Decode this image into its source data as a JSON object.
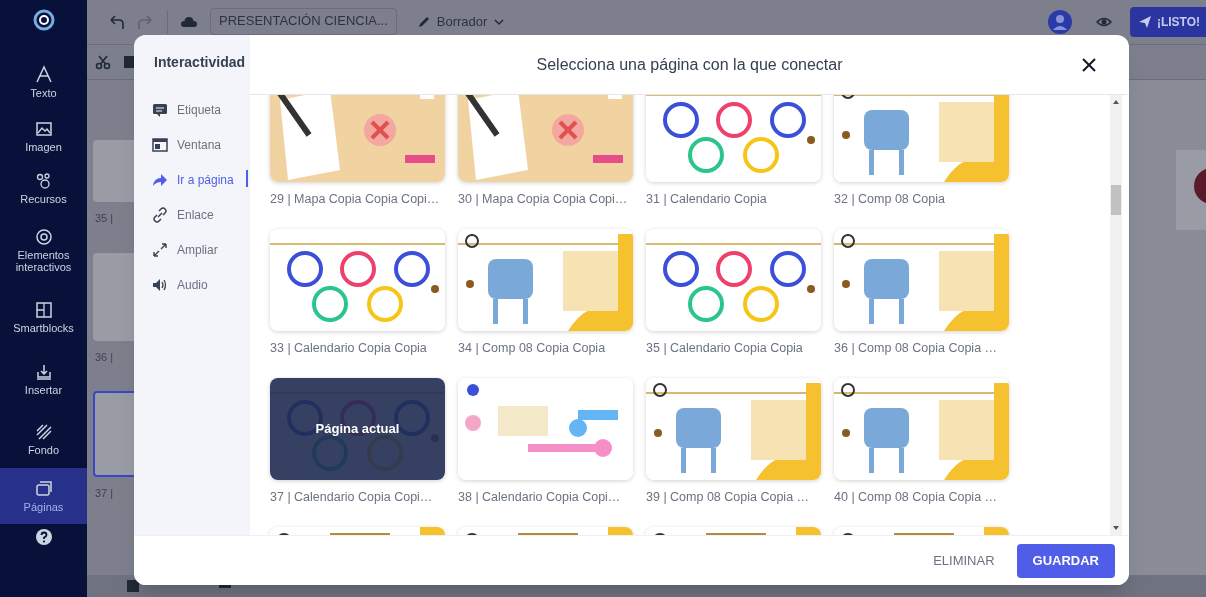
{
  "sidebar": {
    "items": [
      {
        "label": "Texto",
        "selected": false
      },
      {
        "label": "Imagen",
        "selected": false
      },
      {
        "label": "Recursos",
        "selected": false
      },
      {
        "label": "Elementos interactivos",
        "selected": false
      },
      {
        "label": "Smartblocks",
        "selected": false
      },
      {
        "label": "Insertar",
        "selected": false
      },
      {
        "label": "Fondo",
        "selected": false
      },
      {
        "label": "Páginas",
        "selected": true
      }
    ]
  },
  "toolbar": {
    "document_title": "PRESENTACIÓN CIENCIA...",
    "status": "Borrador",
    "publish_button": "¡LISTO!"
  },
  "pages_panel": {
    "pages": [
      {
        "label": "35 |",
        "selected": false
      },
      {
        "label": "36 |",
        "selected": false
      },
      {
        "label": "37 |",
        "selected": true
      }
    ]
  },
  "dialog": {
    "menu_title": "Interactividad",
    "title": "Selecciona una página con la que conectar",
    "menu": [
      {
        "label": "Etiqueta",
        "selected": false
      },
      {
        "label": "Ventana",
        "selected": false
      },
      {
        "label": "Ir a página",
        "selected": true
      },
      {
        "label": "Enlace",
        "selected": false
      },
      {
        "label": "Ampliar",
        "selected": false
      },
      {
        "label": "Audio",
        "selected": false
      }
    ],
    "pages": [
      {
        "label": "29 | Mapa Copia Copia Copi…",
        "current": false
      },
      {
        "label": "30 | Mapa Copia Copia Copi…",
        "current": false
      },
      {
        "label": "31 | Calendario Copia",
        "current": false
      },
      {
        "label": "32 | Comp 08 Copia",
        "current": false
      },
      {
        "label": "33 | Calendario Copia Copia",
        "current": false
      },
      {
        "label": "34 | Comp 08 Copia Copia",
        "current": false
      },
      {
        "label": "35 | Calendario Copia Copia",
        "current": false
      },
      {
        "label": "36 | Comp 08 Copia Copia …",
        "current": false
      },
      {
        "label": "37 | Calendario Copia Copi…",
        "current": true,
        "badge": "Página actual"
      },
      {
        "label": "38 | Calendario Copia Copi…",
        "current": false
      },
      {
        "label": "39 | Comp 08 Copia Copia …",
        "current": false
      },
      {
        "label": "40 | Comp 08 Copia Copia …",
        "current": false
      },
      {
        "current": false
      },
      {
        "current": false
      },
      {
        "current": false
      },
      {
        "current": false
      }
    ],
    "buttons": [
      {
        "label": "ELIMINAR",
        "kind": "text"
      },
      {
        "label": "GUARDAR",
        "kind": "primary"
      }
    ]
  }
}
